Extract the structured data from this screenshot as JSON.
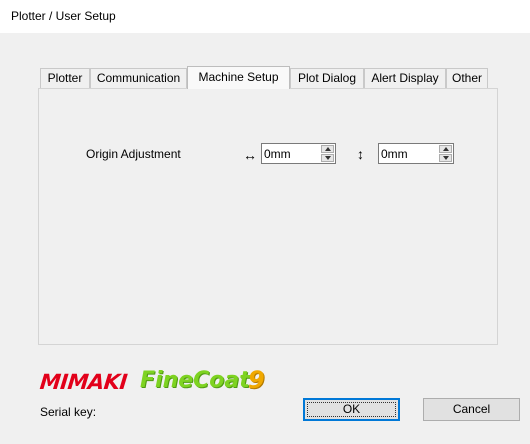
{
  "window": {
    "title": "Plotter / User Setup"
  },
  "tabs": [
    {
      "label": "Plotter",
      "active": false
    },
    {
      "label": "Communication",
      "active": false
    },
    {
      "label": "Machine Setup",
      "active": true
    },
    {
      "label": "Plot Dialog",
      "active": false
    },
    {
      "label": "Alert Display",
      "active": false
    },
    {
      "label": "Other",
      "active": false
    }
  ],
  "machine_setup": {
    "origin_label": "Origin Adjustment",
    "horizontal_arrow": "↔",
    "horizontal_value": "0mm",
    "vertical_arrow": "↕",
    "vertical_value": "0mm"
  },
  "logo": {
    "brand": "MIMAKI",
    "product": "FineCoat",
    "version": "9"
  },
  "footer": {
    "serial_label": "Serial key:",
    "ok_label": "OK",
    "cancel_label": "Cancel"
  },
  "colors": {
    "brand_red": "#e2001a",
    "product_green": "#7ed321",
    "version_orange": "#f0a800",
    "focus_blue": "#0078d7"
  }
}
